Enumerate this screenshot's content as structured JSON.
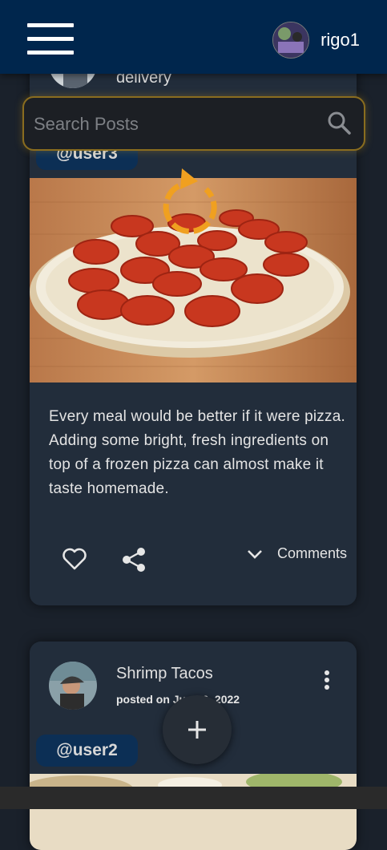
{
  "header": {
    "username": "rigo1",
    "search_placeholder": "Search Posts"
  },
  "posts": [
    {
      "title": "delivery",
      "tag": "@user3",
      "body": "Every meal would be better if it were pizza. Adding some bright, fresh ingredients on top of a frozen pizza can almost make it taste homemade.",
      "comments_label": "Comments"
    },
    {
      "title": "Shrimp Tacos",
      "date": "posted on Jun 16, 2022",
      "tag": "@user2"
    }
  ],
  "colors": {
    "topbar": "#00264d",
    "card": "#222d3b",
    "tag": "#0c2f55",
    "accent_spinner": "#f0a020"
  },
  "icons": [
    "menu-icon",
    "user-avatar",
    "search-icon",
    "loading-spinner-icon",
    "heart-icon",
    "share-icon",
    "chevron-down-icon",
    "more-vert-icon",
    "plus-icon"
  ]
}
